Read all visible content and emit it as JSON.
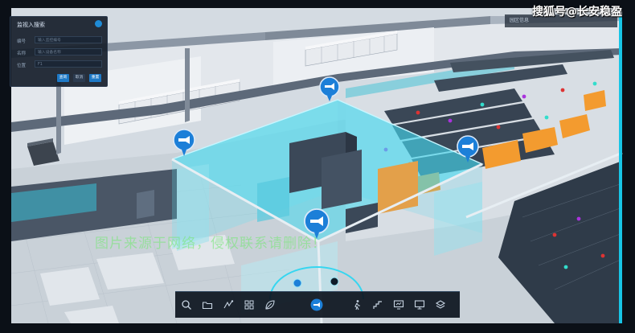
{
  "watermark": {
    "top": "搜狐号@长安稳盈",
    "middle": "图片来源于网络，侵权联系请删除！"
  },
  "search_panel": {
    "title": "监视入搜索",
    "fields": [
      {
        "label": "编号",
        "placeholder": "输入监控编号"
      },
      {
        "label": "名称",
        "placeholder": "输入设备名称"
      },
      {
        "label": "位置",
        "placeholder": "F1"
      }
    ],
    "buttons": [
      "查询",
      "取消",
      "重置"
    ]
  },
  "top_right_panel": {
    "title": "园区信息"
  },
  "colors": {
    "glass": "#35d0e8",
    "floor": "#cfd6dd",
    "rack": "#3a4756",
    "orange_unit": "#f39b2f",
    "marker": "#1c7fd8",
    "accent_green": "#78e678"
  },
  "camera_markers": [
    {
      "name": "camera-marker-left"
    },
    {
      "name": "camera-marker-top"
    },
    {
      "name": "camera-marker-right"
    },
    {
      "name": "camera-marker-bottom"
    }
  ],
  "toolbar": {
    "icons": [
      "search-icon",
      "folder-icon",
      "route-icon",
      "grid-icon",
      "leaf-icon",
      "camera-icon",
      "walk-icon",
      "stairs-icon",
      "monitor-icon",
      "screen-icon",
      "layers-icon"
    ]
  }
}
